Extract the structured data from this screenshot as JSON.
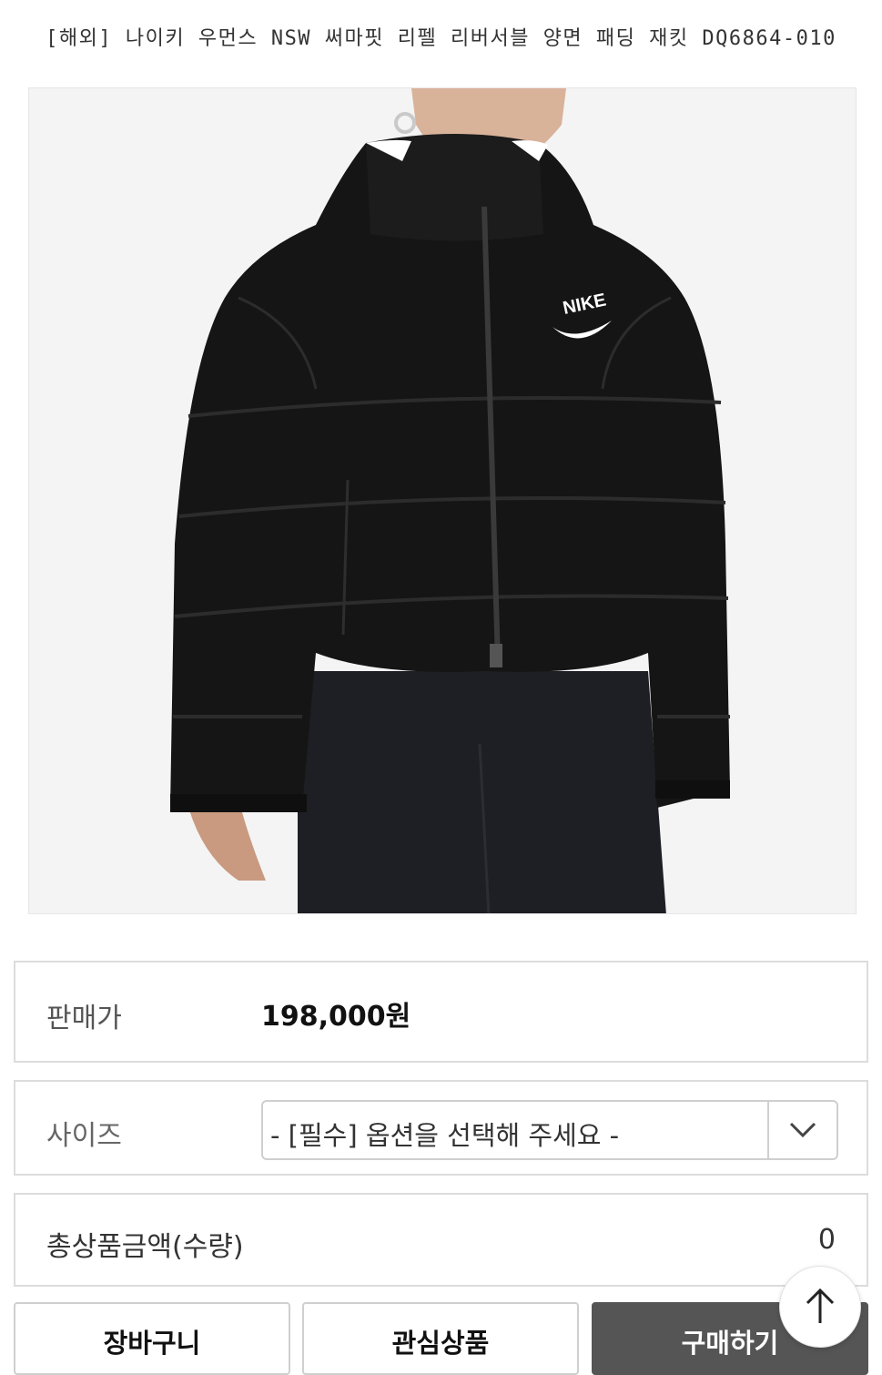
{
  "product": {
    "title": "[해외] 나이키 우먼스 NSW 써마핏 리펠 리버서블 양면 패딩 재킷 DQ6864-010",
    "image_logo_text": "NIKE"
  },
  "price_row": {
    "label": "판매가",
    "value": "198,000원"
  },
  "size_row": {
    "label": "사이즈",
    "select_value": "- [필수] 옵션을 선택해 주세요 -"
  },
  "total_row": {
    "label": "총상품금액(수량)",
    "value": "0"
  },
  "actions": {
    "cart": "장바구니",
    "wishlist": "관심상품",
    "buy": "구매하기"
  },
  "icons": {
    "select": "chevron-down-icon",
    "scroll_top": "arrow-up-icon"
  }
}
